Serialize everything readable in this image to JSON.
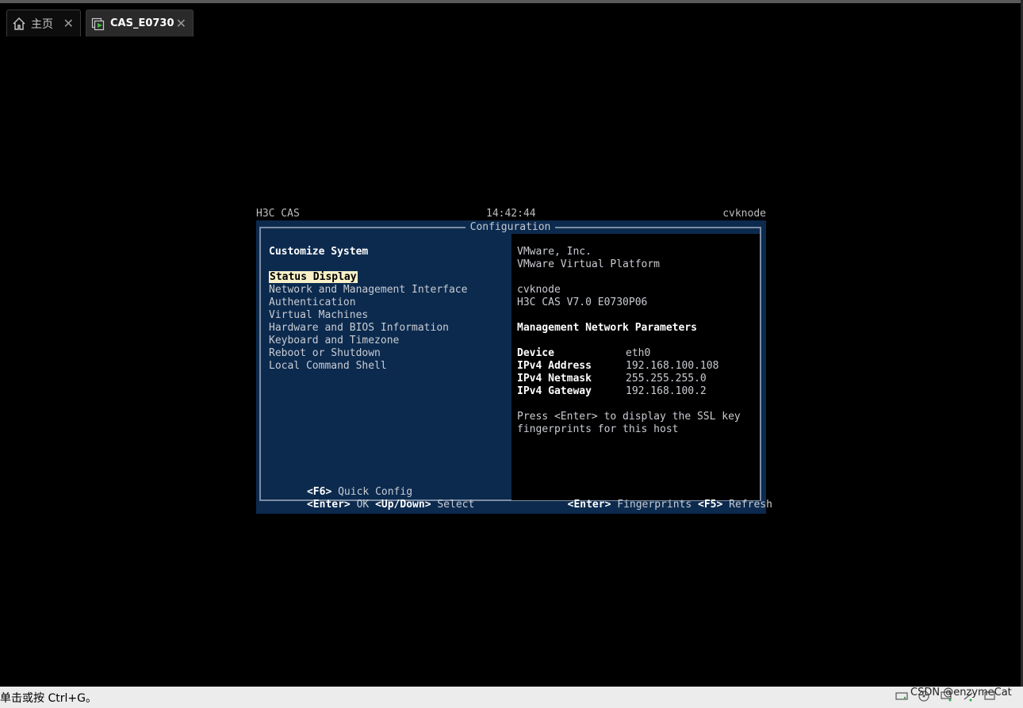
{
  "tabs": [
    {
      "label": "主页",
      "icon": "home-icon"
    },
    {
      "label": "CAS_E0730",
      "icon": "vm-running-icon"
    }
  ],
  "console": {
    "header_left": "H3C CAS",
    "header_time": "14:42:44",
    "header_right": "cvknode",
    "title": "Configuration",
    "menu_heading": "Customize System",
    "menu_items": [
      "Status Display",
      "Network and Management Interface",
      "Authentication",
      "Virtual Machines",
      "Hardware and BIOS Information",
      "Keyboard and Timezone",
      "Reboot or Shutdown",
      "Local Command Shell"
    ],
    "left_footer": {
      "f6_key": "<F6>",
      "f6_label": "Quick Config",
      "enter_key": "<Enter>",
      "enter_label": "OK",
      "updown_key": "<Up/Down>",
      "updown_label": "Select"
    },
    "info": {
      "vendor": "VMware, Inc.",
      "platform": "VMware Virtual Platform",
      "hostname": "cvknode",
      "version": "H3C CAS V7.0 E0730P06",
      "section_title": "Management Network Parameters",
      "params": [
        {
          "label": "Device",
          "value": "eth0"
        },
        {
          "label": "IPv4 Address",
          "value": "192.168.100.108"
        },
        {
          "label": "IPv4 Netmask",
          "value": "255.255.255.0"
        },
        {
          "label": "IPv4 Gateway",
          "value": "192.168.100.2"
        }
      ],
      "hint_line1": "Press <Enter> to display the SSL key",
      "hint_line2": "fingerprints for this host"
    },
    "right_footer": {
      "enter_key": "<Enter>",
      "enter_label": "Fingerprints",
      "f5_key": "<F5>",
      "f5_label": "Refresh"
    }
  },
  "statusbar": {
    "text": "单击或按 Ctrl+G。",
    "watermark": "CSDN @enzymeCat"
  }
}
